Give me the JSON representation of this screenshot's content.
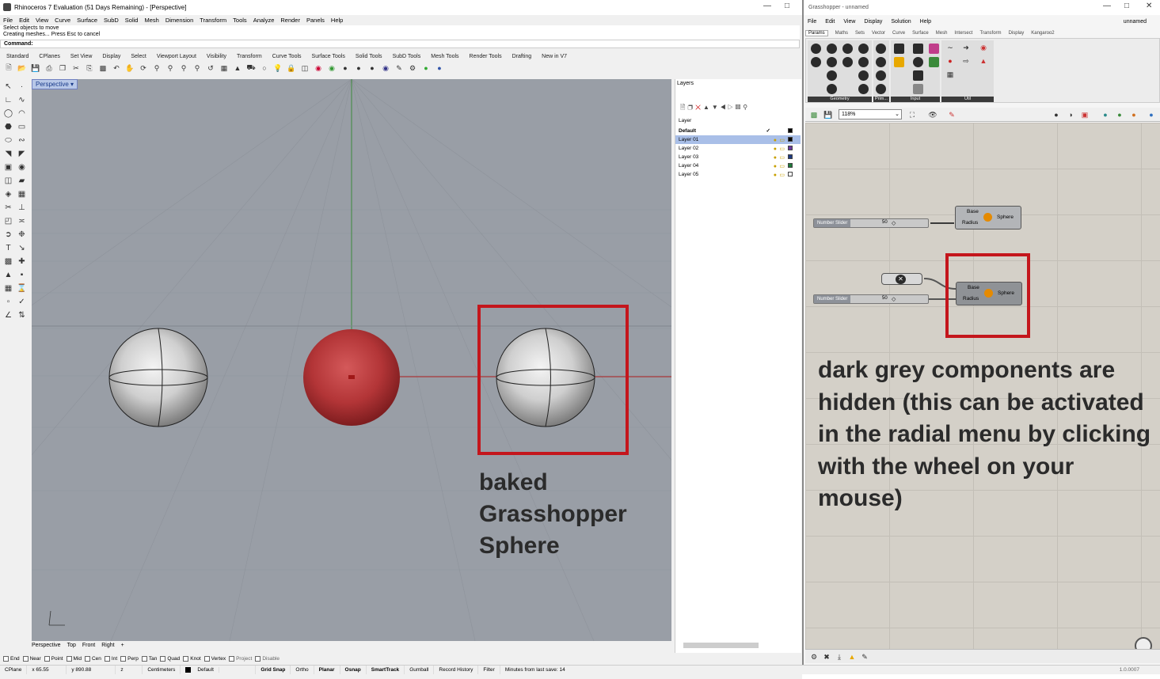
{
  "rhino": {
    "title": "Rhinoceros 7 Evaluation (51 Days Remaining) - [Perspective]",
    "menu": [
      "File",
      "Edit",
      "View",
      "Curve",
      "Surface",
      "SubD",
      "Solid",
      "Mesh",
      "Dimension",
      "Transform",
      "Tools",
      "Analyze",
      "Render",
      "Panels",
      "Help"
    ],
    "cmd_history": [
      "Select objects to move",
      "Creating meshes... Press Esc to cancel"
    ],
    "cmd_prompt": "Command:",
    "toolbar_tabs": [
      "Standard",
      "CPlanes",
      "Set View",
      "Display",
      "Select",
      "Viewport Layout",
      "Visibility",
      "Transform",
      "Curve Tools",
      "Surface Tools",
      "Solid Tools",
      "SubD Tools",
      "Mesh Tools",
      "Render Tools",
      "Drafting",
      "New in V7"
    ],
    "viewport_label": "Perspective",
    "viewport_tabs": [
      "Perspective",
      "Top",
      "Front",
      "Right"
    ],
    "layers": {
      "panel_title": "Layers",
      "col_header": "Layer",
      "rows": [
        {
          "name": "Default",
          "color": "#000000",
          "current": true
        },
        {
          "name": "Layer 01",
          "color": "#000000",
          "selected": true
        },
        {
          "name": "Layer 02",
          "color": "#6a3aa0"
        },
        {
          "name": "Layer 03",
          "color": "#1f3a80"
        },
        {
          "name": "Layer 04",
          "color": "#1f7a3a"
        },
        {
          "name": "Layer 05",
          "color": "#ffffff"
        }
      ]
    },
    "osnaps": [
      "End",
      "Near",
      "Point",
      "Mid",
      "Cen",
      "Int",
      "Perp",
      "Tan",
      "Quad",
      "Knot",
      "Vertex",
      "Project",
      "Disable"
    ],
    "annotation": [
      "baked",
      "Grasshopper",
      "Sphere"
    ]
  },
  "status_bar": {
    "cplane": "CPlane",
    "x": "x 65.55",
    "y": "y 890.88",
    "z": "z",
    "units": "Centimeters",
    "layer": "Default",
    "toggles": [
      "Grid Snap",
      "Ortho",
      "Planar",
      "Osnap",
      "SmartTrack",
      "Gumball",
      "Record History",
      "Filter"
    ],
    "save_info": "Minutes from last save: 14"
  },
  "grasshopper": {
    "title": "Grasshopper - unnamed",
    "doc_name": "unnamed",
    "menu": [
      "File",
      "Edit",
      "View",
      "Display",
      "Solution",
      "Help"
    ],
    "tabs": [
      "Params",
      "Maths",
      "Sets",
      "Vector",
      "Curve",
      "Surface",
      "Mesh",
      "Intersect",
      "Transform",
      "Display",
      "Kangaroo2"
    ],
    "groups": [
      "Geometry",
      "Prim...",
      "Input",
      "Util"
    ],
    "zoom": "118%",
    "slider_label": "Number Slider",
    "slider_value": "50",
    "inputs": [
      "Base",
      "Radius"
    ],
    "component_name": "Sphere",
    "version": "1.0.0007",
    "annotation": "dark grey components are hidden (this can be activated in the radial menu by clicking with the wheel on your mouse)"
  },
  "colors": {
    "annotation_box": "#c4161c",
    "viewport_bg": "#999ea6",
    "gh_canvas": "#d4d0c8"
  }
}
